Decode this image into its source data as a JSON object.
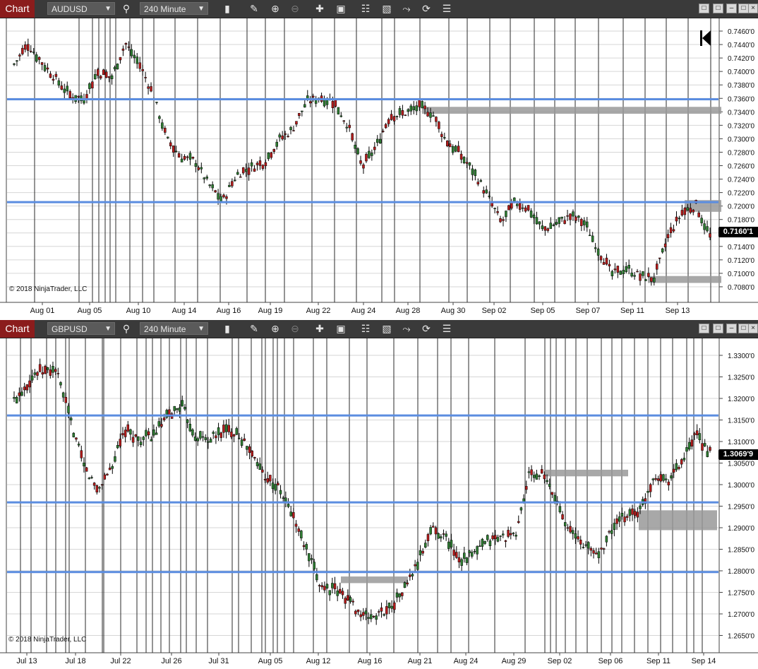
{
  "charts": [
    {
      "tab_label": "Chart",
      "instrument": "AUDUSD",
      "interval": "240 Minute",
      "copyright": "© 2018 NinjaTrader, LLC",
      "last_price_label": "0.7160'1",
      "y_ticks": [
        "0.7460'0",
        "0.7440'0",
        "0.7420'0",
        "0.7400'0",
        "0.7380'0",
        "0.7360'0",
        "0.7340'0",
        "0.7320'0",
        "0.7300'0",
        "0.7280'0",
        "0.7260'0",
        "0.7240'0",
        "0.7220'0",
        "0.7200'0",
        "0.7180'0",
        "0.7160'0",
        "0.7140'0",
        "0.7120'0",
        "0.7100'0",
        "0.7080'0"
      ],
      "x_ticks": [
        "Aug 01",
        "Aug 05",
        "Aug 10",
        "Aug 14",
        "Aug 16",
        "Aug 19",
        "Aug 22",
        "Aug 24",
        "Aug 28",
        "Aug 30",
        "Sep 02",
        "Sep 05",
        "Sep 07",
        "Sep 11",
        "Sep 13"
      ],
      "colors": {
        "up": "#2e7d32",
        "down": "#b71c1c",
        "hline": "#5b8de0",
        "zone": "#999999"
      }
    },
    {
      "tab_label": "Chart",
      "instrument": "GBPUSD",
      "interval": "240 Minute",
      "copyright": "© 2018 NinjaTrader, LLC",
      "last_price_label": "1.3069'9",
      "y_ticks": [
        "1.3300'0",
        "1.3250'0",
        "1.3200'0",
        "1.3150'0",
        "1.3100'0",
        "1.3050'0",
        "1.3000'0",
        "1.2950'0",
        "1.2900'0",
        "1.2850'0",
        "1.2800'0",
        "1.2750'0",
        "1.2700'0",
        "1.2650'0"
      ],
      "x_ticks": [
        "Jul 13",
        "Jul 18",
        "Jul 22",
        "Jul 26",
        "Jul 31",
        "Aug 05",
        "Aug 12",
        "Aug 16",
        "Aug 21",
        "Aug 24",
        "Aug 29",
        "Sep 02",
        "Sep 06",
        "Sep 11",
        "Sep 14"
      ],
      "colors": {
        "up": "#2e7d32",
        "down": "#b71c1c",
        "hline": "#5b8de0",
        "zone": "#999999"
      }
    }
  ],
  "toolbar_icons": [
    "search-icon",
    "bar-type-icon",
    "pencil-icon",
    "zoom-in-icon",
    "zoom-out-icon",
    "crosshair-icon",
    "data-box-icon",
    "indicators-icon",
    "strategies-icon",
    "drawing-tools-icon",
    "refresh-icon",
    "properties-icon"
  ],
  "chart_data": [
    {
      "type": "candlestick",
      "instrument": "AUDUSD",
      "y_range": [
        0.707,
        0.747
      ],
      "horizontal_lines": [
        0.7359,
        0.721
      ],
      "zones": [
        {
          "x_start": "Aug 28",
          "x_end": "right-edge",
          "y_low": 0.7338,
          "y_high": 0.7348
        },
        {
          "x_start": "Sep 13",
          "x_end": "right-edge",
          "y_low": 0.7196,
          "y_high": 0.7213
        },
        {
          "x_start": "Sep 11",
          "x_end": "right-edge",
          "y_low": 0.7093,
          "y_high": 0.7103
        }
      ],
      "path": [
        [
          0.0,
          0.741
        ],
        [
          0.02,
          0.7438
        ],
        [
          0.05,
          0.74
        ],
        [
          0.08,
          0.7365
        ],
        [
          0.1,
          0.736
        ],
        [
          0.12,
          0.7398
        ],
        [
          0.14,
          0.739
        ],
        [
          0.16,
          0.744
        ],
        [
          0.18,
          0.741
        ],
        [
          0.2,
          0.7365
        ],
        [
          0.22,
          0.73
        ],
        [
          0.24,
          0.7275
        ],
        [
          0.26,
          0.727
        ],
        [
          0.28,
          0.7235
        ],
        [
          0.3,
          0.7212
        ],
        [
          0.32,
          0.725
        ],
        [
          0.34,
          0.726
        ],
        [
          0.36,
          0.7268
        ],
        [
          0.38,
          0.73
        ],
        [
          0.4,
          0.7315
        ],
        [
          0.42,
          0.7355
        ],
        [
          0.44,
          0.7362
        ],
        [
          0.46,
          0.7355
        ],
        [
          0.48,
          0.732
        ],
        [
          0.5,
          0.726
        ],
        [
          0.52,
          0.729
        ],
        [
          0.54,
          0.7335
        ],
        [
          0.56,
          0.7338
        ],
        [
          0.58,
          0.7348
        ],
        [
          0.6,
          0.734
        ],
        [
          0.62,
          0.73
        ],
        [
          0.64,
          0.728
        ],
        [
          0.66,
          0.7255
        ],
        [
          0.68,
          0.722
        ],
        [
          0.7,
          0.718
        ],
        [
          0.72,
          0.721
        ],
        [
          0.74,
          0.72
        ],
        [
          0.76,
          0.717
        ],
        [
          0.78,
          0.718
        ],
        [
          0.8,
          0.719
        ],
        [
          0.82,
          0.718
        ],
        [
          0.84,
          0.714
        ],
        [
          0.86,
          0.7105
        ],
        [
          0.88,
          0.7115
        ],
        [
          0.9,
          0.7102
        ],
        [
          0.92,
          0.71
        ],
        [
          0.94,
          0.716
        ],
        [
          0.96,
          0.7195
        ],
        [
          0.98,
          0.7205
        ],
        [
          1.0,
          0.716
        ]
      ]
    },
    {
      "type": "candlestick",
      "instrument": "GBPUSD",
      "y_range": [
        1.263,
        1.332
      ],
      "horizontal_lines": [
        1.3155,
        1.2958,
        1.28
      ],
      "zones": [
        {
          "x_start": "Aug 16",
          "x_end": "Aug 21",
          "y_low": 1.2775,
          "y_high": 1.279
        },
        {
          "x_start": "Aug 29",
          "x_end": "Sep 06",
          "y_low": 1.3017,
          "y_high": 1.3032
        },
        {
          "x_start": "Sep 11",
          "x_end": "right-edge",
          "y_low": 1.2895,
          "y_high": 1.294
        }
      ],
      "path": [
        [
          0.0,
          1.319
        ],
        [
          0.03,
          1.325
        ],
        [
          0.06,
          1.326
        ],
        [
          0.08,
          1.315
        ],
        [
          0.1,
          1.304
        ],
        [
          0.12,
          1.2985
        ],
        [
          0.14,
          1.304
        ],
        [
          0.16,
          1.312
        ],
        [
          0.18,
          1.31
        ],
        [
          0.2,
          1.311
        ],
        [
          0.22,
          1.315
        ],
        [
          0.24,
          1.318
        ],
        [
          0.26,
          1.311
        ],
        [
          0.28,
          1.31
        ],
        [
          0.3,
          1.312
        ],
        [
          0.32,
          1.312
        ],
        [
          0.34,
          1.307
        ],
        [
          0.36,
          1.302
        ],
        [
          0.38,
          1.299
        ],
        [
          0.4,
          1.293
        ],
        [
          0.42,
          1.285
        ],
        [
          0.44,
          1.277
        ],
        [
          0.46,
          1.276
        ],
        [
          0.48,
          1.274
        ],
        [
          0.5,
          1.27
        ],
        [
          0.52,
          1.27
        ],
        [
          0.54,
          1.272
        ],
        [
          0.56,
          1.276
        ],
        [
          0.58,
          1.282
        ],
        [
          0.6,
          1.29
        ],
        [
          0.62,
          1.288
        ],
        [
          0.64,
          1.283
        ],
        [
          0.66,
          1.284
        ],
        [
          0.68,
          1.287
        ],
        [
          0.7,
          1.288
        ],
        [
          0.72,
          1.288
        ],
        [
          0.74,
          1.302
        ],
        [
          0.76,
          1.302
        ],
        [
          0.78,
          1.296
        ],
        [
          0.8,
          1.289
        ],
        [
          0.82,
          1.286
        ],
        [
          0.84,
          1.284
        ],
        [
          0.86,
          1.29
        ],
        [
          0.88,
          1.293
        ],
        [
          0.9,
          1.294
        ],
        [
          0.92,
          1.302
        ],
        [
          0.94,
          1.301
        ],
        [
          0.96,
          1.305
        ],
        [
          0.98,
          1.311
        ],
        [
          1.0,
          1.307
        ]
      ]
    }
  ]
}
